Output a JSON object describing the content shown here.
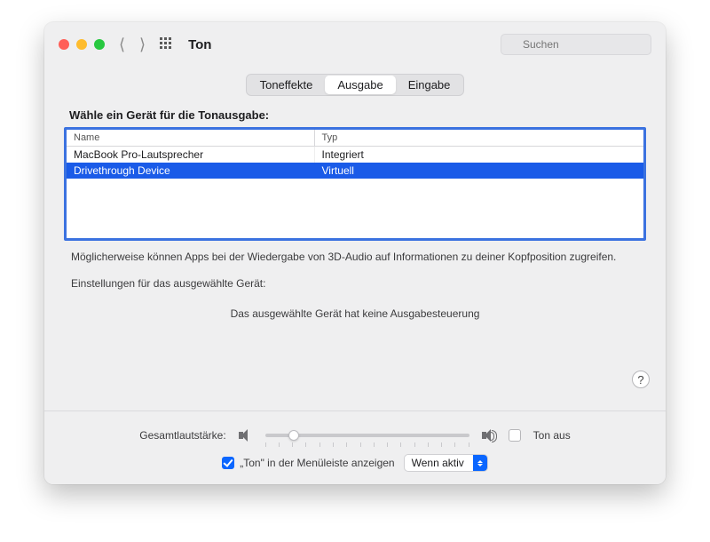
{
  "window": {
    "title": "Ton"
  },
  "search": {
    "placeholder": "Suchen"
  },
  "tabs": {
    "effects": "Toneffekte",
    "output": "Ausgabe",
    "input": "Eingabe"
  },
  "output": {
    "section_label": "Wähle ein Gerät für die Tonausgabe:",
    "columns": {
      "name": "Name",
      "type": "Typ"
    },
    "rows": [
      {
        "name": "MacBook Pro-Lautsprecher",
        "type": "Integriert",
        "selected": false
      },
      {
        "name": "Drivethrough Device",
        "type": "Virtuell",
        "selected": true
      }
    ],
    "info_text": "Möglicherweise können Apps bei der Wiedergabe von 3D-Audio auf Informationen zu deiner Kopfposition zugreifen.",
    "settings_label": "Einstellungen für das ausgewählte Gerät:",
    "no_controls": "Das ausgewählte Gerät hat keine Ausgabesteuerung"
  },
  "volume": {
    "label": "Gesamtlautstärke:",
    "mute_label": "Ton aus"
  },
  "menubar": {
    "checkbox_label": "„Ton\" in der Menüleiste anzeigen",
    "select_value": "Wenn aktiv"
  },
  "help": {
    "symbol": "?"
  }
}
